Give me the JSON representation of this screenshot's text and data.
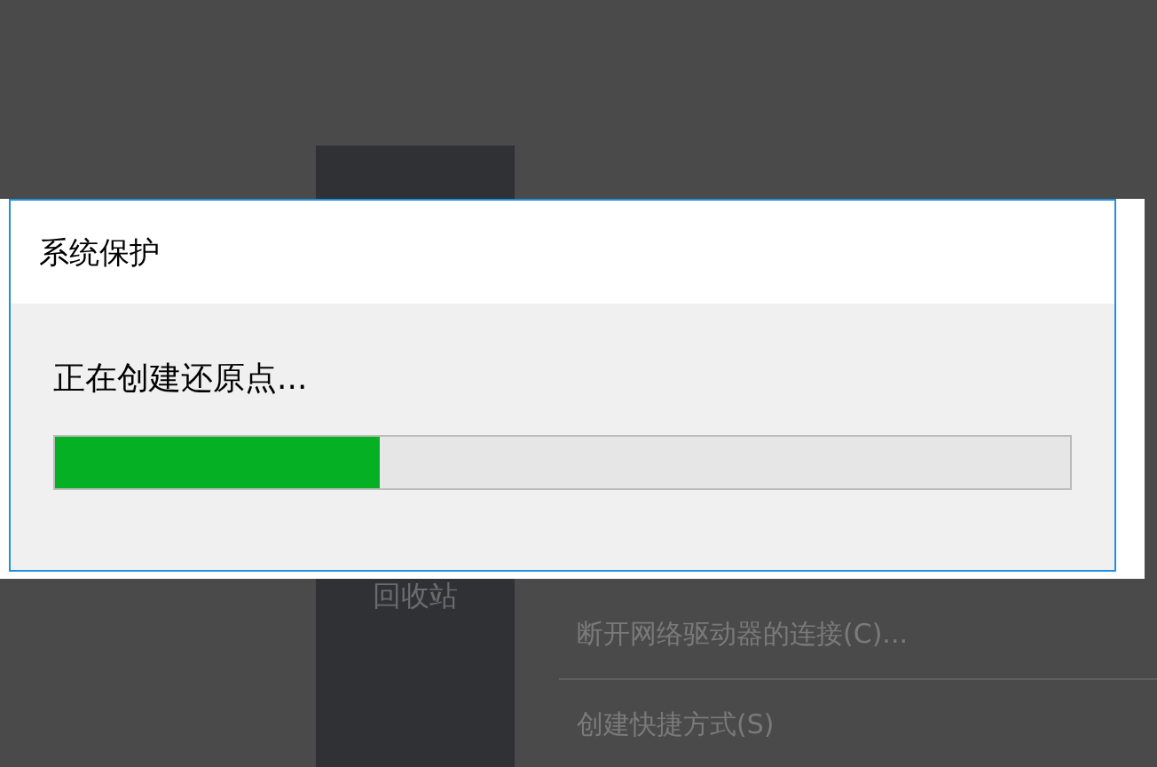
{
  "dialog": {
    "title": "系统保护",
    "message": "正在创建还原点...",
    "progress": {
      "level": 0.32
    }
  },
  "desktop": {
    "recycle_bin": {
      "label": "回收站"
    },
    "context_menu": {
      "items": [
        {
          "kind": "item",
          "label": "断开网络驱动器的连接(C)..."
        },
        {
          "kind": "separator"
        },
        {
          "kind": "item",
          "label": "创建快捷方式(S)"
        }
      ]
    }
  }
}
